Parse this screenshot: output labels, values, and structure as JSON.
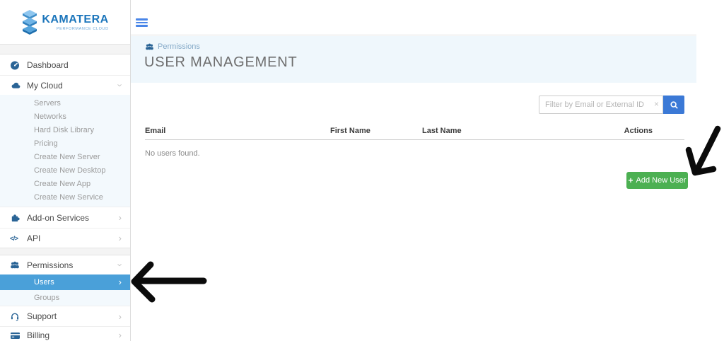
{
  "logo": {
    "brand": "KAMATERA",
    "tagline": "PERFORMANCE CLOUD"
  },
  "sidebar": {
    "dashboard": "Dashboard",
    "my_cloud": "My Cloud",
    "servers": "Servers",
    "networks": "Networks",
    "hard_disk_library": "Hard Disk Library",
    "pricing": "Pricing",
    "create_new_server": "Create New Server",
    "create_new_desktop": "Create New Desktop",
    "create_new_app": "Create New App",
    "create_new_service": "Create New Service",
    "addon_services": "Add-on Services",
    "api": "API",
    "permissions": "Permissions",
    "users": "Users",
    "groups": "Groups",
    "support": "Support",
    "billing": "Billing"
  },
  "header": {
    "breadcrumb": "Permissions",
    "title": "USER MANAGEMENT"
  },
  "filter": {
    "placeholder": "Filter by Email or External ID"
  },
  "table": {
    "headers": {
      "email": "Email",
      "first_name": "First Name",
      "last_name": "Last Name",
      "actions": "Actions"
    },
    "empty": "No users found."
  },
  "buttons": {
    "add_new_user": "Add New User"
  },
  "icons": {
    "chevron": "›",
    "clear": "×",
    "plus": "+",
    "code": "</>"
  },
  "colors": {
    "brand_blue": "#1b75bb",
    "icon_blue": "#2a6496",
    "selected_blue": "#4aa0d9",
    "search_blue": "#3b79d6",
    "hamburger_blue": "#4a86e8",
    "button_green": "#4cb052",
    "panel_bg": "#eff7fc",
    "submenu_bg": "#f3f9fd"
  }
}
